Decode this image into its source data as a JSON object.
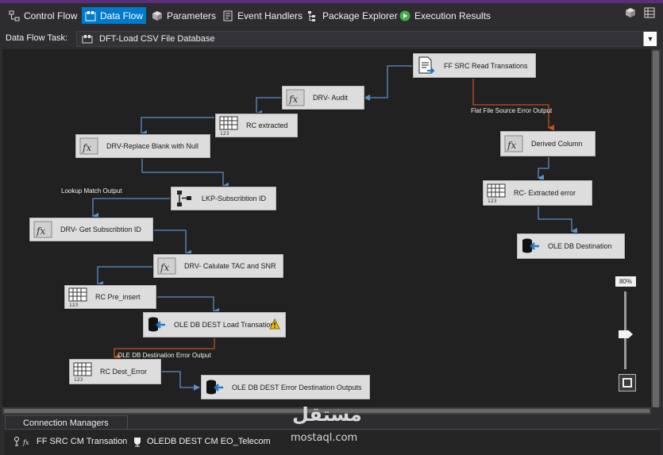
{
  "tabs": [
    {
      "label": "Control Flow",
      "icon": "control-flow-icon",
      "active": false
    },
    {
      "label": "Data Flow",
      "icon": "data-flow-icon",
      "active": true
    },
    {
      "label": "Parameters",
      "icon": "parameters-icon",
      "active": false
    },
    {
      "label": "Event Handlers",
      "icon": "event-handlers-icon",
      "active": false
    },
    {
      "label": "Package Explorer",
      "icon": "package-explorer-icon",
      "active": false
    },
    {
      "label": "Execution Results",
      "icon": "play-icon",
      "active": false
    }
  ],
  "task": {
    "label": "Data Flow Task:",
    "value": "DFT-Load CSV File Database"
  },
  "nodes": {
    "ff_src": {
      "label": "FF SRC Read Transations",
      "icon": "flat-file-source-icon"
    },
    "drv_audit": {
      "label": "DRV- Audit",
      "icon": "derived-column-icon"
    },
    "rc_extracted": {
      "label": "RC extracted",
      "icon": "row-count-icon"
    },
    "drv_replace": {
      "label": "DRV-Replace Blank with Null",
      "icon": "derived-column-icon"
    },
    "lkp_sub": {
      "label": "LKP-Subscribtion ID",
      "icon": "lookup-icon"
    },
    "drv_get_sub": {
      "label": "DRV- Get Subscribtion ID",
      "icon": "derived-column-icon"
    },
    "drv_calc": {
      "label": "DRV- Calulate TAC and SNR",
      "icon": "derived-column-icon"
    },
    "rc_pre_insert": {
      "label": "RC Pre_insert",
      "icon": "row-count-icon"
    },
    "ole_dest_load": {
      "label": "OLE DB DEST Load Transations",
      "icon": "ole-db-destination-icon"
    },
    "rc_dest_error": {
      "label": "RC Dest_Error",
      "icon": "row-count-icon"
    },
    "ole_dest_error": {
      "label": "OLE DB DEST Error Destination Outputs",
      "icon": "ole-db-destination-icon"
    },
    "derived_column": {
      "label": "Derived Column",
      "icon": "derived-column-icon"
    },
    "rc_extracted_error": {
      "label": "RC- Extracted error",
      "icon": "row-count-icon"
    },
    "ole_db_destination": {
      "label": "OLE DB Destination",
      "icon": "ole-db-destination-icon"
    }
  },
  "path_labels": {
    "flat_file_error": "Flat File Source Error Output",
    "lookup_match": "Lookup Match Output",
    "ole_db_error": "OLE DB Destination Error Output"
  },
  "zoom": {
    "label": "80%",
    "level": 0.8
  },
  "connection_managers": {
    "tab_label": "Connection Managers",
    "items": [
      {
        "label": "FF SRC CM Transation",
        "icon": "flat-file-connection-icon"
      },
      {
        "label": "OLEDB DEST CM EO_Telecom",
        "icon": "database-connection-icon"
      }
    ]
  },
  "watermark": {
    "arabic": "مستقل",
    "latin": "mostaql.com"
  },
  "colors": {
    "accent": "#007acc",
    "canvas": "#212121",
    "success_path": "#5b8fc6",
    "error_path": "#c0501e",
    "node_fill": "#dddddd"
  }
}
